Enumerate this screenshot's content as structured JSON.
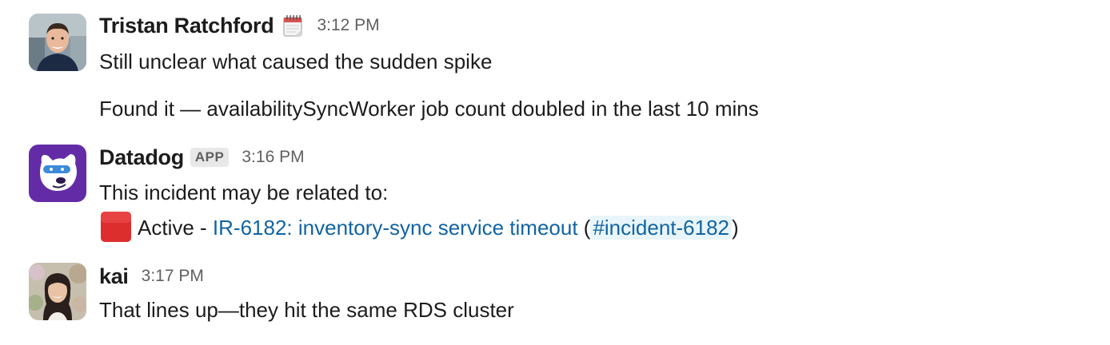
{
  "messages": [
    {
      "author": "Tristan Ratchford",
      "status_emoji": "spiral-calendar-icon",
      "time": "3:12 PM",
      "lines": [
        "Still unclear what caused the sudden spike",
        "Found it — availabilitySyncWorker job count doubled in the last 10 mins"
      ]
    },
    {
      "author": "Datadog",
      "badge": "APP",
      "time": "3:16 PM",
      "line1": "This incident may be related to:",
      "incident": {
        "status_icon": "red-square-icon",
        "status_text": "Active - ",
        "link_text": "IR-6182: inventory-sync service timeout",
        "open_paren": " (",
        "channel": "#incident-6182",
        "close_paren": ")"
      }
    },
    {
      "author": "kai",
      "time": "3:17 PM",
      "lines": [
        "That lines up—they hit the same RDS cluster"
      ]
    }
  ],
  "colors": {
    "link": "#1264a3",
    "channel_bg": "#e8f5fa",
    "timestamp": "#616061",
    "text": "#1d1c1d",
    "datadog_purple": "#632ca6"
  }
}
